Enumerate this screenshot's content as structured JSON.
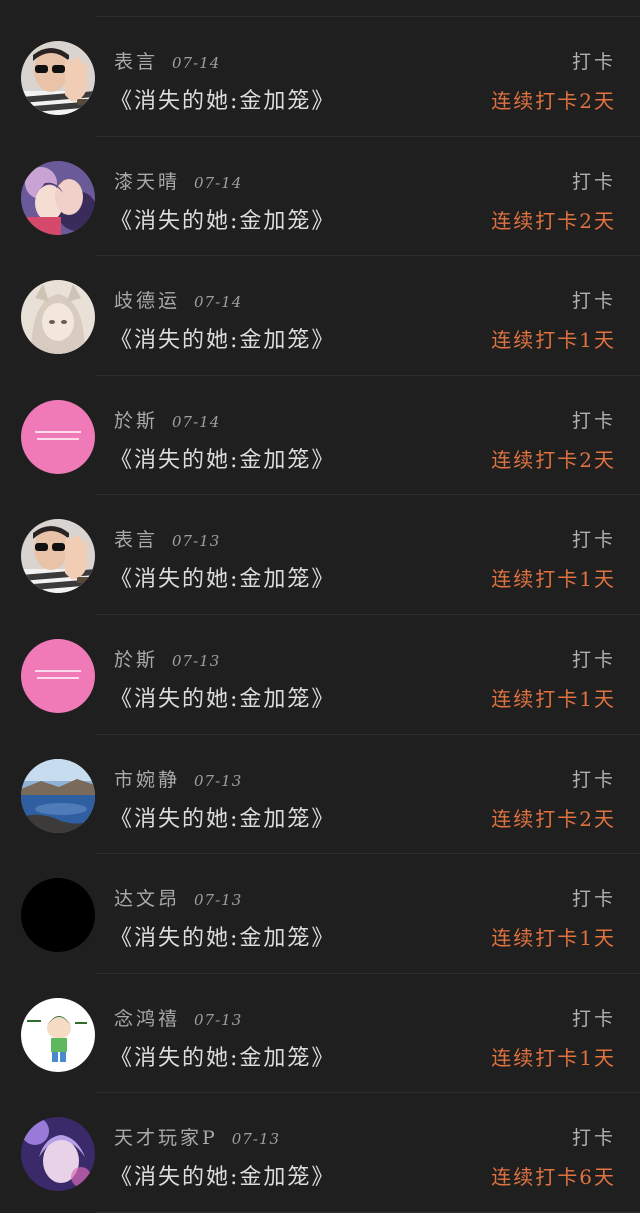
{
  "feed": {
    "items": [
      {
        "name": "表言",
        "date": "07-14",
        "book": "《消失的她:金加笼》",
        "action": "打卡",
        "streak": "连续打卡2天",
        "avatar": "sunglasses-photo"
      },
      {
        "name": "漆天晴",
        "date": "07-14",
        "book": "《消失的她:金加笼》",
        "action": "打卡",
        "streak": "连续打卡2天",
        "avatar": "anime-couple"
      },
      {
        "name": "歧德运",
        "date": "07-14",
        "book": "《消失的她:金加笼》",
        "action": "打卡",
        "streak": "连续打卡1天",
        "avatar": "light-portrait"
      },
      {
        "name": "於斯",
        "date": "07-14",
        "book": "《消失的她:金加笼》",
        "action": "打卡",
        "streak": "连续打卡2天",
        "avatar": "pink-text"
      },
      {
        "name": "表言",
        "date": "07-13",
        "book": "《消失的她:金加笼》",
        "action": "打卡",
        "streak": "连续打卡1天",
        "avatar": "sunglasses-photo"
      },
      {
        "name": "於斯",
        "date": "07-13",
        "book": "《消失的她:金加笼》",
        "action": "打卡",
        "streak": "连续打卡1天",
        "avatar": "pink-text"
      },
      {
        "name": "市婉静",
        "date": "07-13",
        "book": "《消失的她:金加笼》",
        "action": "打卡",
        "streak": "连续打卡2天",
        "avatar": "lake-landscape"
      },
      {
        "name": "达文昂",
        "date": "07-13",
        "book": "《消失的她:金加笼》",
        "action": "打卡",
        "streak": "连续打卡1天",
        "avatar": "black"
      },
      {
        "name": "念鸿禧",
        "date": "07-13",
        "book": "《消失的她:金加笼》",
        "action": "打卡",
        "streak": "连续打卡1天",
        "avatar": "cartoon-kid"
      },
      {
        "name": "天才玩家P",
        "date": "07-13",
        "book": "《消失的她:金加笼》",
        "action": "打卡",
        "streak": "连续打卡6天",
        "avatar": "purple-anime"
      }
    ]
  },
  "colors": {
    "background": "#1f1f20",
    "streak": "#e0733f",
    "pink_avatar": "#f07ab8"
  }
}
